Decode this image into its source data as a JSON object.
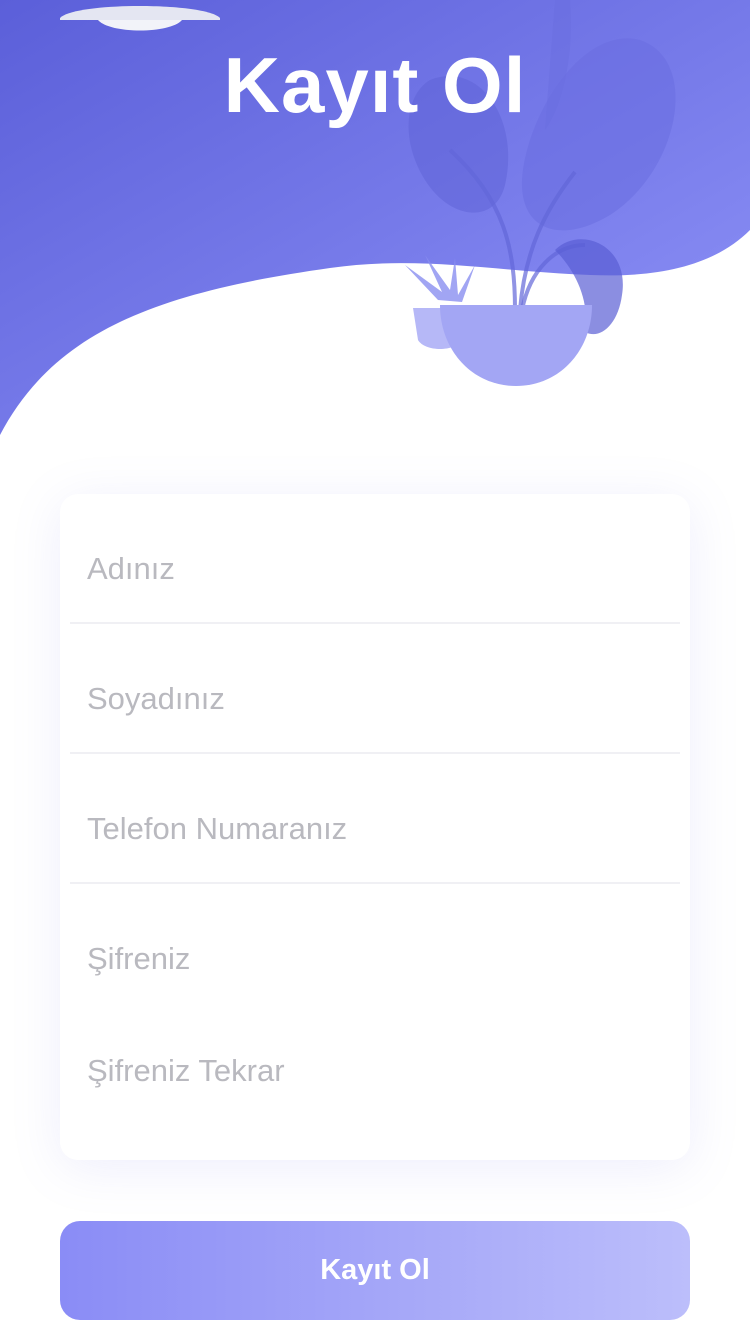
{
  "header": {
    "title": "Kayıt Ol"
  },
  "form": {
    "fields": [
      {
        "placeholder": "Adınız",
        "type": "text"
      },
      {
        "placeholder": "Soyadınız",
        "type": "text"
      },
      {
        "placeholder": "Telefon Numaranız",
        "type": "tel"
      },
      {
        "placeholder": "Şifreniz",
        "type": "password"
      },
      {
        "placeholder": "Şifreniz Tekrar",
        "type": "password"
      }
    ]
  },
  "submit": {
    "label": "Kayıt Ol"
  },
  "colors": {
    "header_gradient_start": "#5b5fd9",
    "header_gradient_end": "#8a8ef7",
    "accent": "#8a8cf6",
    "placeholder_text": "#b9b9bf"
  },
  "illustrations": {
    "top_left": "lamp-shade-icon",
    "top_right": "potted-plant-icon"
  }
}
